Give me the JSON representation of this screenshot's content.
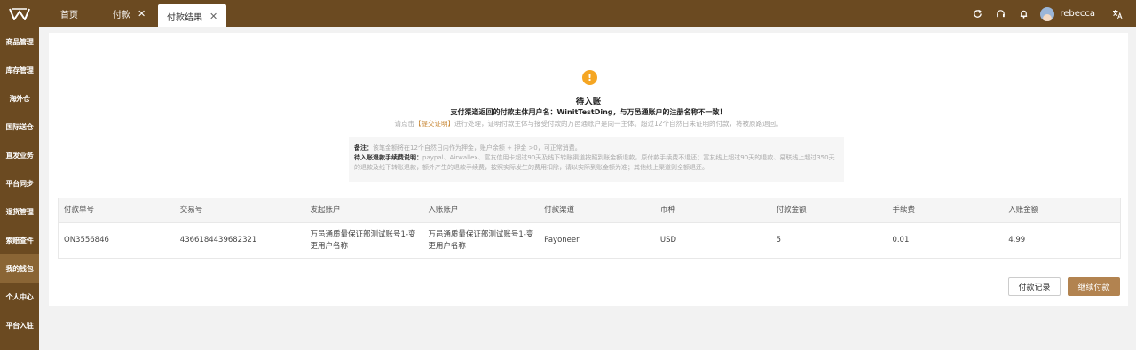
{
  "header": {
    "tabs": [
      {
        "label": "首页",
        "closable": false,
        "active": false
      },
      {
        "label": "付款",
        "closable": true,
        "active": false
      },
      {
        "label": "付款结果",
        "closable": true,
        "active": true
      }
    ],
    "close_glyph": "✕",
    "username": "rebecca",
    "icons": [
      "refresh-icon",
      "headset-icon",
      "bell-icon",
      "avatar",
      "translate-icon"
    ]
  },
  "sidebar": {
    "items": [
      {
        "label": "商品管理",
        "active": false
      },
      {
        "label": "库存管理",
        "active": false
      },
      {
        "label": "海外仓",
        "active": false
      },
      {
        "label": "国际送仓",
        "active": false
      },
      {
        "label": "直发业务",
        "active": false
      },
      {
        "label": "平台同步",
        "active": false
      },
      {
        "label": "退货管理",
        "active": false
      },
      {
        "label": "索赔查件",
        "active": false
      },
      {
        "label": "我的钱包",
        "active": true
      },
      {
        "label": "个人中心",
        "active": false
      },
      {
        "label": "平台入驻",
        "active": false
      }
    ]
  },
  "result": {
    "icon_glyph": "!",
    "title": "待入账",
    "message": "支付渠道返回的付款主体用户名：WinitTestDing，与万邑通账户的注册名称不一致！",
    "hint_prefix": "请点击",
    "hint_link": "【提交证明】",
    "hint_suffix": "进行处理，证明付款主体与接受付款的万邑通账户是同一主体。超过12个自然日未证明的付款，将被原路退回。"
  },
  "note": {
    "remark_label": "备注：",
    "remark_text": "该笔金额将在12个自然日内作为押金，账户余额 + 押金 >0，可正常消费。",
    "fee_label": "待入账退款手续费说明：",
    "fee_text": "paypal、Airwallex、富友信用卡超过90天及线下转账渠道按照到账金额退款，原付款手续费不退还；富友线上超过90天的退款、易联线上超过350天的退款及线下转账退款，额外产生的退款手续费，按照实际发生的费用扣除，请以实际到账金额为准；其他线上渠道则全额退还。"
  },
  "table": {
    "columns": [
      "付款单号",
      "交易号",
      "发起账户",
      "入账账户",
      "付款渠道",
      "币种",
      "付款金额",
      "手续费",
      "入账金额"
    ],
    "rows": [
      [
        "ON3556846",
        "4366184439682321",
        "万邑通质量保证部测试账号1-变更用户名称",
        "万邑通质量保证部测试账号1-变更用户名称",
        "Payoneer",
        "USD",
        "5",
        "0.01",
        "4.99"
      ]
    ]
  },
  "actions": {
    "records_label": "付款记录",
    "continue_label": "继续付款"
  },
  "colors": {
    "brand": "#6b4a21",
    "accent": "#b28350",
    "warning": "#f5a623"
  }
}
